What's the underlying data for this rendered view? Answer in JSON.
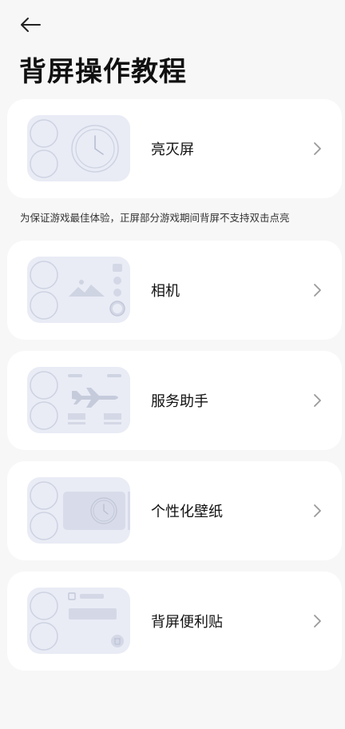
{
  "header": {
    "back_icon": "back-arrow-icon",
    "title": "背屏操作教程"
  },
  "items": [
    {
      "label": "亮灭屏",
      "icon": "clock-thumbnail"
    },
    {
      "label": "相机",
      "icon": "camera-thumbnail"
    },
    {
      "label": "服务助手",
      "icon": "airplane-thumbnail"
    },
    {
      "label": "个性化壁纸",
      "icon": "wallpaper-thumbnail"
    },
    {
      "label": "背屏便利贴",
      "icon": "sticky-note-thumbnail"
    }
  ],
  "note": "为保证游戏最佳体验，正屏部分游戏期间背屏不支持双击点亮",
  "colors": {
    "background": "#f7f7f7",
    "card": "#ffffff",
    "thumbnail": "#e9ecf5",
    "thumbnail_stroke": "#cdd2e2",
    "chevron": "#9a9a9a"
  }
}
